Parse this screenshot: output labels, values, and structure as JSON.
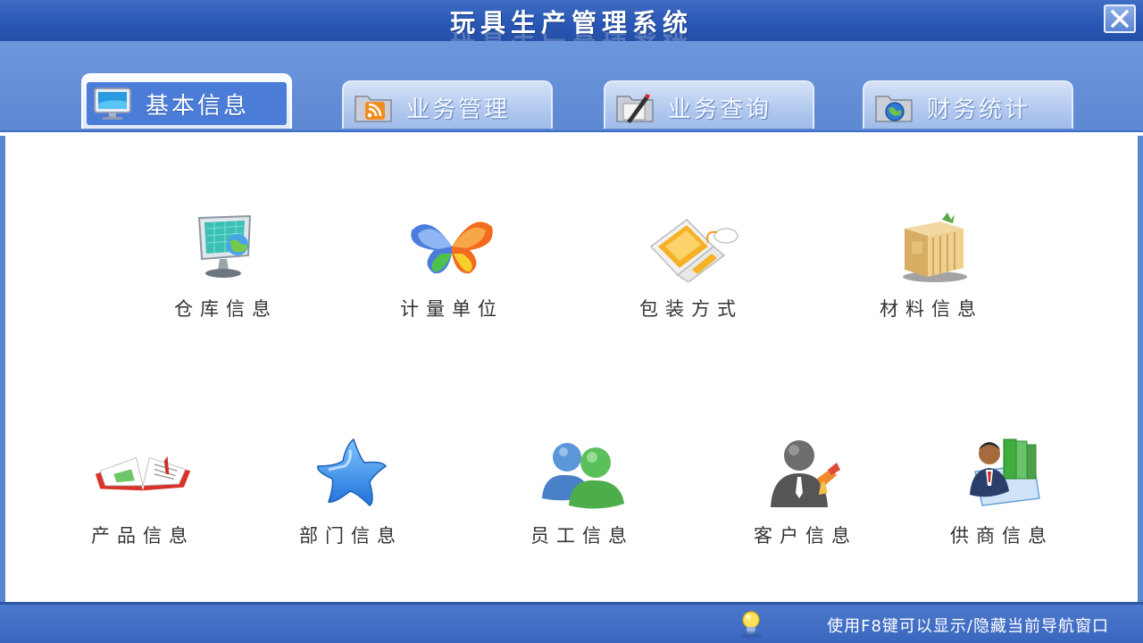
{
  "window": {
    "title": "玩具生产管理系统"
  },
  "tabs": [
    {
      "label": "基本信息",
      "icon": "monitor-icon",
      "active": true
    },
    {
      "label": "业务管理",
      "icon": "rss-folder-icon",
      "active": false
    },
    {
      "label": "业务查询",
      "icon": "pen-folder-icon",
      "active": false
    },
    {
      "label": "财务统计",
      "icon": "globe-folder-icon",
      "active": false
    }
  ],
  "items": [
    {
      "label": "仓库信息",
      "icon": "monitor-globe-icon"
    },
    {
      "label": "计量单位",
      "icon": "butterfly-icon"
    },
    {
      "label": "包装方式",
      "icon": "laptop-mouse-icon"
    },
    {
      "label": "材料信息",
      "icon": "boxes-icon"
    },
    {
      "label": "产品信息",
      "icon": "open-book-icon"
    },
    {
      "label": "部门信息",
      "icon": "star-icon"
    },
    {
      "label": "员工信息",
      "icon": "users-icon"
    },
    {
      "label": "客户信息",
      "icon": "customer-icon"
    },
    {
      "label": "供商信息",
      "icon": "supplier-icon"
    }
  ],
  "status": {
    "hint": "使用F8键可以显示/隐藏当前导航窗口",
    "icon": "lightbulb-icon"
  },
  "colors": {
    "title_bar": "#2a58b6",
    "frame": "#5b86d0",
    "active_tab": "#4a7cd8",
    "status_bar": "#3a66bf"
  }
}
